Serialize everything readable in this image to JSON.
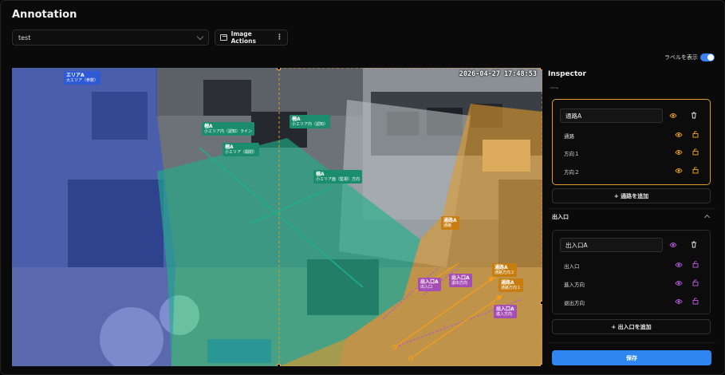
{
  "app": {
    "title": "Annotation"
  },
  "toolbar": {
    "project_select_value": "test",
    "image_actions_label": "Image Actions",
    "show_labels_label": "ラベルを表示",
    "show_labels_on": true
  },
  "canvas": {
    "timestamp": "2026-04-27 17:48:53",
    "tags": [
      {
        "id": "area-a",
        "title": "エリアA",
        "sub": "大エリア（参数）",
        "color": "blue"
      },
      {
        "id": "fence-a1",
        "title": "柵A",
        "sub": "小エリア内（認知）ライン",
        "color": "teal"
      },
      {
        "id": "fence-a2",
        "title": "柵A",
        "sub": "小エリア（開閉）",
        "color": "teal"
      },
      {
        "id": "fence-a3",
        "title": "柵A",
        "sub": "小エリア内（認知）",
        "color": "teal"
      },
      {
        "id": "fence-a4",
        "title": "柵A",
        "sub": "小エリア面（監視）方向",
        "color": "teal"
      },
      {
        "id": "passage-a1",
        "title": "通路A",
        "sub": "通路",
        "color": "orange"
      },
      {
        "id": "passage-a2",
        "title": "通路A",
        "sub": "通路方向２",
        "color": "orange"
      },
      {
        "id": "passage-a3",
        "title": "通路A",
        "sub": "通路方向１",
        "color": "orange"
      },
      {
        "id": "exit-a1",
        "title": "出入口A",
        "sub": "出入口",
        "color": "purple"
      },
      {
        "id": "exit-a2",
        "title": "出入口A",
        "sub": "退出方向",
        "color": "purple"
      },
      {
        "id": "exit-a3",
        "title": "出入口A",
        "sub": "進入方向",
        "color": "purple"
      }
    ]
  },
  "inspector": {
    "title": "Inspector",
    "cut_header": "通路",
    "passage_card": {
      "name_value": "通路A",
      "rows": [
        {
          "label": "通路"
        },
        {
          "label": "方向１"
        },
        {
          "label": "方向２"
        }
      ]
    },
    "add_passage_label": "+ 通路を追加",
    "exit_section_title": "出入口",
    "exit_card": {
      "name_value": "出入口A",
      "rows": [
        {
          "label": "出入口"
        },
        {
          "label": "進入方向"
        },
        {
          "label": "退出方向"
        }
      ]
    },
    "add_exit_label": "+ 出入口を追加",
    "save_label": "保存"
  },
  "colors": {
    "accent_blue": "#2f86f1",
    "passage_orange": "#e09a2a",
    "exit_purple": "#b057d6",
    "area_blue": "#2f4fd6",
    "fence_teal": "#1fb089"
  },
  "icons": [
    "chevron-down-icon",
    "image-icon",
    "more-vertical-icon",
    "eye-icon",
    "trash-icon",
    "lock-open-icon",
    "chevron-up-icon"
  ]
}
